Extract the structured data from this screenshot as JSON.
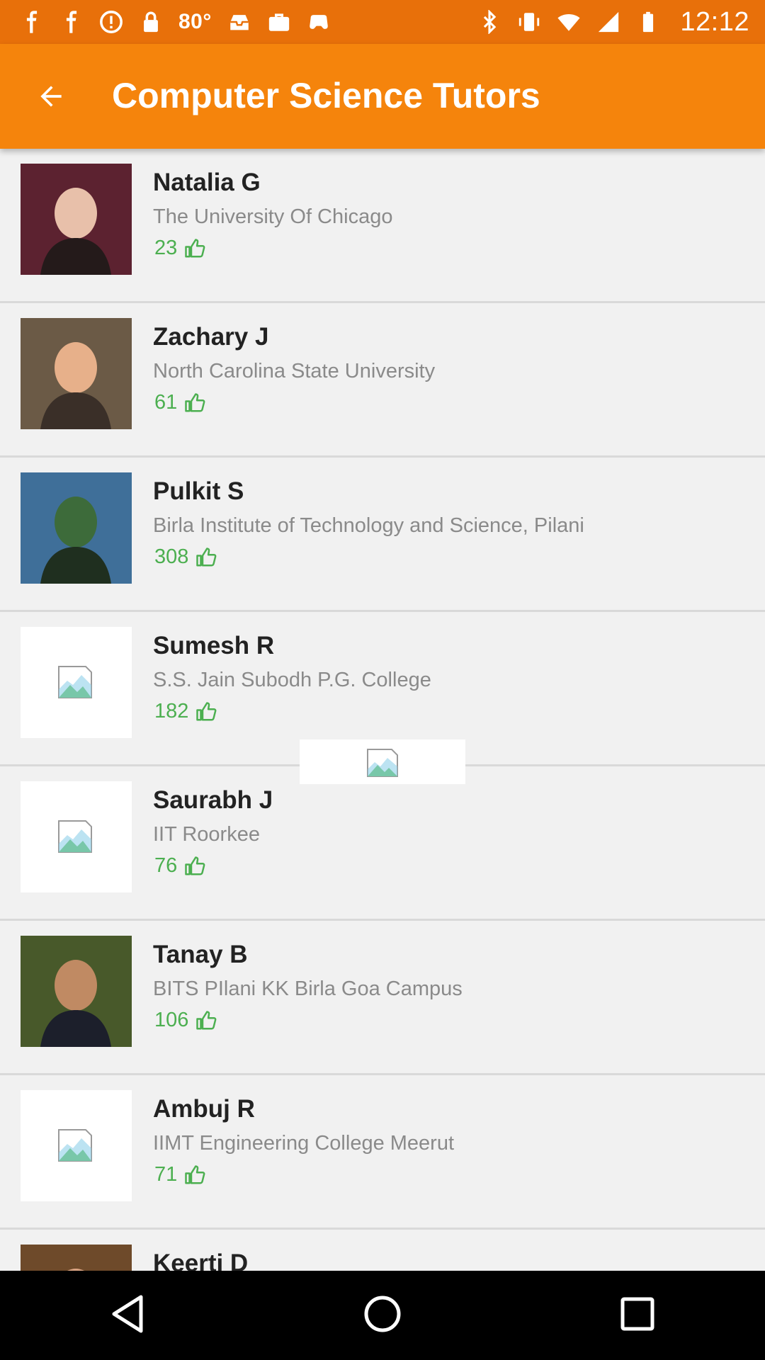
{
  "status_bar": {
    "temperature": "80°",
    "time": "12:12"
  },
  "app_bar": {
    "title": "Computer Science Tutors",
    "back_icon": "arrow-back-icon"
  },
  "tutors": [
    {
      "name": "Natalia G",
      "school": "The University Of Chicago",
      "likes": "23",
      "photo": "photo"
    },
    {
      "name": "Zachary J",
      "school": "North Carolina State University",
      "likes": "61",
      "photo": "photo"
    },
    {
      "name": "Pulkit S",
      "school": "Birla Institute of Technology and Science, Pilani",
      "likes": "308",
      "photo": "photo"
    },
    {
      "name": "Sumesh R",
      "school": "S.S. Jain Subodh P.G. College",
      "likes": "182",
      "photo": "broken-image"
    },
    {
      "name": "Saurabh J",
      "school": "IIT Roorkee",
      "likes": "76",
      "photo": "broken-image"
    },
    {
      "name": "Tanay B",
      "school": "BITS PIlani KK Birla Goa Campus",
      "likes": "106",
      "photo": "photo"
    },
    {
      "name": "Ambuj R",
      "school": "IIMT Engineering College Meerut",
      "likes": "71",
      "photo": "broken-image"
    },
    {
      "name": "Keerti D",
      "school": "",
      "likes": "",
      "photo": "photo"
    }
  ],
  "colors": {
    "status_bar": "#e8700a",
    "app_bar": "#f5840c",
    "likes": "#4caf50"
  },
  "nav_bar": {
    "icons": [
      "back-triangle-icon",
      "home-circle-icon",
      "recents-square-icon"
    ]
  }
}
